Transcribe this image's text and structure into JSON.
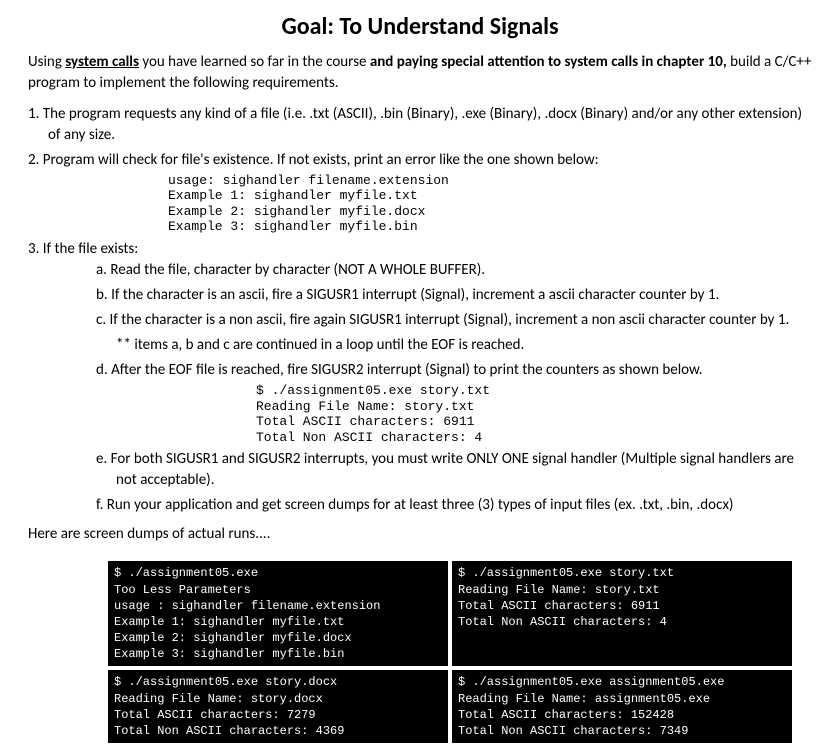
{
  "header_title": "Goal:  To Understand Signals",
  "intro": {
    "part1": "Using ",
    "bold_underline": "system calls",
    "part2": " you have learned so far in the course ",
    "bold2": "and paying special attention to system calls in chapter 10,",
    "part3": " build a C/C++ program to implement the following requirements."
  },
  "item1": "The program requests any kind of a file (i.e. .txt (ASCII), .bin (Binary), .exe (Binary), .docx (Binary) and/or any other extension) of any size.",
  "item2": "Program will check for file's existence. If not exists, print an error like the one shown below:",
  "code2": "usage: sighandler filename.extension\nExample 1: sighandler myfile.txt\nExample 2: sighandler myfile.docx\nExample 3: sighandler myfile.bin",
  "item3": "If the file exists:",
  "sub_a": "Read the file, character by character (NOT A WHOLE BUFFER).",
  "sub_b": "If the character is an ascii, fire a SIGUSR1 interrupt (Signal), increment a ascii character counter by 1.",
  "sub_c": "If the character is a non ascii, fire again SIGUSR1 interrupt (Signal), increment a non ascii character counter by 1.",
  "note": "** items a, b and c are continued in a loop until the EOF is reached.",
  "sub_d": "After the EOF file is reached, fire SIGUSR2 interrupt (Signal) to print the counters as shown below.",
  "code_d": "$ ./assignment05.exe story.txt\nReading File Name: story.txt\nTotal ASCII characters: 6911\nTotal Non ASCII characters: 4",
  "sub_e": "For both SIGUSR1 and SIGUSR2 interrupts, you must write ONLY ONE signal handler (Multiple signal handlers are not acceptable).",
  "sub_f": "Run your application and get screen dumps for at least three (3) types of input files (ex. .txt, .bin, .docx)",
  "screendumps_intro": "Here are screen dumps of actual runs....",
  "terminals": {
    "tl": "$ ./assignment05.exe\nToo Less Parameters\nusage : sighandler filename.extension\nExample 1: sighandler myfile.txt\nExample 2: sighandler myfile.docx\nExample 3: sighandler myfile.bin",
    "tr": "$ ./assignment05.exe story.txt\nReading File Name: story.txt\nTotal ASCII characters: 6911\nTotal Non ASCII characters: 4",
    "bl": "$ ./assignment05.exe story.docx\nReading File Name: story.docx\nTotal ASCII characters: 7279\nTotal Non ASCII characters: 4369",
    "br": "$ ./assignment05.exe assignment05.exe\nReading File Name: assignment05.exe\nTotal ASCII characters: 152428\nTotal Non ASCII characters: 7349"
  }
}
